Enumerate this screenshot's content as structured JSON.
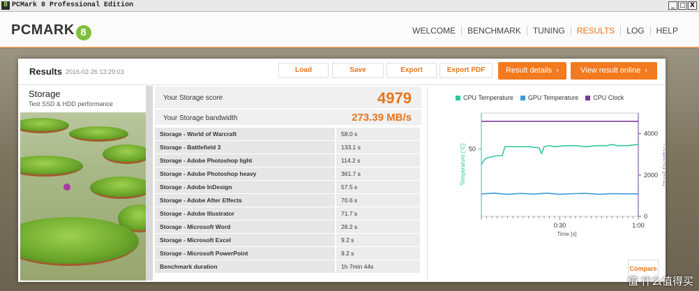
{
  "window": {
    "title": "PCMark 8 Professional Edition",
    "minimize": "_",
    "maximize": "□",
    "close": "X"
  },
  "nav": {
    "logo": "PCMARK",
    "logo_badge": "8",
    "items": [
      "WELCOME",
      "BENCHMARK",
      "TUNING",
      "RESULTS",
      "LOG",
      "HELP"
    ],
    "active": "RESULTS"
  },
  "results": {
    "title": "Results",
    "date": "2016-02-26 13:29:03",
    "buttons": {
      "load": "Load",
      "save": "Save",
      "export": "Export",
      "export_pdf": "Export PDF",
      "result_details": "Result details",
      "view_online": "View result online"
    }
  },
  "test": {
    "name": "Storage",
    "description": "Test SSD & HDD performance"
  },
  "score": {
    "label": "Your Storage score",
    "value": "4979",
    "bandwidth_label": "Your Storage bandwidth",
    "bandwidth_value": "273.39 MB/s"
  },
  "table": [
    {
      "name": "Storage - World of Warcraft",
      "value": "58.0 s"
    },
    {
      "name": "Storage - Battlefield 3",
      "value": "133.1 s"
    },
    {
      "name": "Storage - Adobe Photoshop light",
      "value": "114.2 s"
    },
    {
      "name": "Storage - Adobe Photoshop heavy",
      "value": "361.7 s"
    },
    {
      "name": "Storage - Adobe InDesign",
      "value": "57.5 s"
    },
    {
      "name": "Storage - Adobe After Effects",
      "value": "70.6 s"
    },
    {
      "name": "Storage - Adobe Illustrator",
      "value": "71.7 s"
    },
    {
      "name": "Storage - Microsoft Word",
      "value": "28.2 s"
    },
    {
      "name": "Storage - Microsoft Excel",
      "value": "9.2 s"
    },
    {
      "name": "Storage - Microsoft PowerPoint",
      "value": "9.2 s"
    },
    {
      "name": "Benchmark duration",
      "value": "1h 7min 44s"
    }
  ],
  "compare_button": "Compare",
  "watermark": "值 什么值得买",
  "chart_data": {
    "type": "line",
    "xlabel": "Time [s]",
    "ylabel_left": "Temperature [°C]",
    "ylabel_right": "Frequency [MHz]",
    "x_ticks": [
      "0:30",
      "1:00"
    ],
    "x_tick_values": [
      30,
      60
    ],
    "xlim": [
      0,
      60
    ],
    "y_left_ticks": [
      "50"
    ],
    "y_left_tick_values": [
      50
    ],
    "y_left_lim": [
      20,
      66
    ],
    "y_right_ticks": [
      "4000",
      "2000",
      "0"
    ],
    "y_right_tick_values": [
      4000,
      2000,
      0
    ],
    "y_right_lim": [
      0,
      5000
    ],
    "legend_position": "top",
    "series": [
      {
        "name": "CPU Temperature",
        "color": "#2ec6a0",
        "axis": "left",
        "x": [
          0,
          1,
          2,
          4,
          6,
          8,
          9,
          12,
          14,
          18,
          22,
          23,
          24,
          26,
          28,
          32,
          36,
          40,
          44,
          48,
          50,
          52,
          56,
          60
        ],
        "y": [
          43,
          45,
          46,
          46.5,
          47,
          47,
          51,
          51,
          51,
          51,
          50.5,
          48,
          51,
          51.5,
          51,
          51.5,
          51.5,
          51,
          51.5,
          51.5,
          52,
          51.5,
          51.5,
          52
        ]
      },
      {
        "name": "GPU Temperature",
        "color": "#3a9ad9",
        "axis": "left",
        "x": [
          0,
          5,
          10,
          15,
          20,
          25,
          30,
          35,
          40,
          45,
          50,
          55,
          60
        ],
        "y": [
          30,
          30.3,
          29.8,
          30.2,
          29.9,
          30.3,
          29.8,
          30.1,
          30.2,
          29.8,
          30.1,
          30,
          30
        ]
      },
      {
        "name": "CPU Clock",
        "color": "#7a3a9a",
        "axis": "right",
        "x": [
          0,
          60
        ],
        "y": [
          4600,
          4600
        ]
      }
    ]
  }
}
